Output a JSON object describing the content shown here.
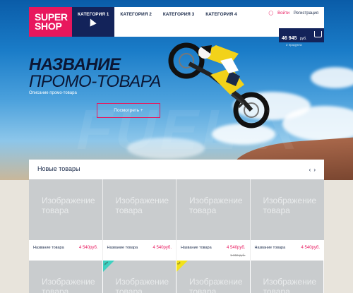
{
  "logo": {
    "line1": "SUPER",
    "line2": "SHOP"
  },
  "nav": {
    "categories": [
      "Категория 1",
      "Категория 2",
      "Категория 3",
      "Категория 4"
    ],
    "login": "Войти",
    "register": "Регистрация"
  },
  "cart": {
    "sum": "46 945",
    "currency": "руб.",
    "count": "2 продукта"
  },
  "promo": {
    "title_line1": "НАЗВАНИЕ",
    "title_line2": "ПРОМО-ТОВАРА",
    "description": "Описание промо-товара",
    "button": "Посмотреть  +"
  },
  "products": {
    "heading": "Новые товары",
    "prev": "‹",
    "next": "›",
    "items": [
      {
        "image": "Изображение товара",
        "name": "Название товара",
        "price": "4 540руб.",
        "old_price": ""
      },
      {
        "image": "Изображение товара",
        "name": "Название товара",
        "price": "4 540руб.",
        "old_price": ""
      },
      {
        "image": "Изображение товара",
        "name": "Название товара",
        "price": "4 540руб.",
        "old_price": "5 950 руб."
      },
      {
        "image": "Изображение товара",
        "name": "Название товара",
        "price": "4 540руб.",
        "old_price": ""
      }
    ],
    "second_row": [
      {
        "image": "Изображение товара",
        "badge": ""
      },
      {
        "image": "Изображение товара",
        "badge": "new"
      },
      {
        "image": "Изображение товара",
        "badge": "hot"
      },
      {
        "image": "Изображение товара",
        "badge": ""
      }
    ]
  },
  "colors": {
    "accent": "#e8175d",
    "navy": "#13235a",
    "new_badge": "#3fd0c0",
    "hot_badge": "#f2e21a"
  }
}
